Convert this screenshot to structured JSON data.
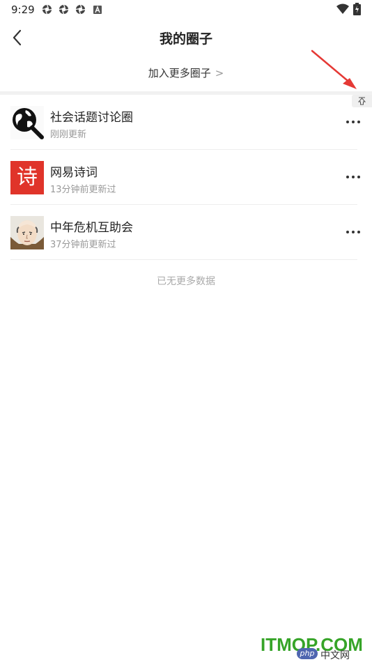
{
  "status_bar": {
    "time": "9:29",
    "icons": [
      "aperture-icon",
      "aperture-icon",
      "aperture-icon",
      "a-badge-icon"
    ],
    "right_icons": [
      "wifi-icon",
      "battery-charging-icon"
    ]
  },
  "header": {
    "title": "我的圈子"
  },
  "join_more": {
    "label": "加入更多圈子",
    "chevron": ">"
  },
  "circles": [
    {
      "name": "社会话题讨论圈",
      "updated": "刚刚更新",
      "avatar_icon": "globe-magnifier-icon"
    },
    {
      "name": "网易诗词",
      "updated": "13分钟前更新过",
      "avatar_icon": "poem-character-icon",
      "avatar_text": "诗",
      "avatar_color": "#e0342a"
    },
    {
      "name": "中年危机互助会",
      "updated": "37分钟前更新过",
      "avatar_icon": "bald-man-avatar-icon"
    }
  ],
  "footer_note": "已无更多数据",
  "watermark": {
    "main": "ITMOP.COM",
    "php": "php",
    "cn": "中文网"
  },
  "colors": {
    "annotation_arrow": "#e53935",
    "watermark_green": "#36a428"
  }
}
